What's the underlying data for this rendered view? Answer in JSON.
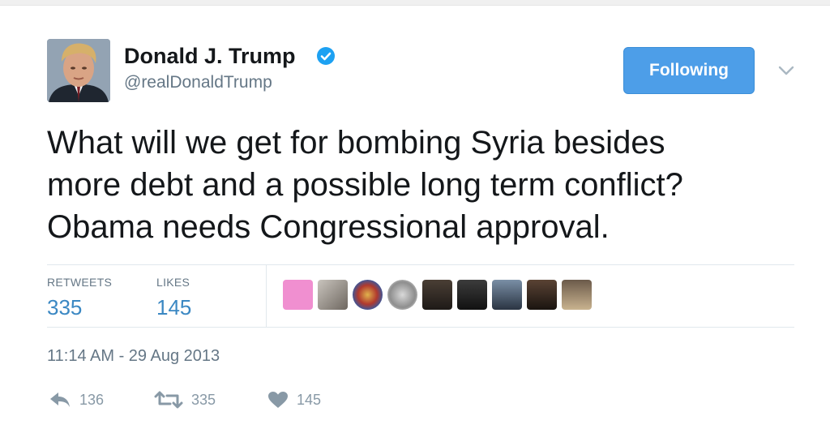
{
  "user": {
    "display_name": "Donald J. Trump",
    "handle": "@realDonaldTrump",
    "verified": true
  },
  "follow_button": {
    "label": "Following"
  },
  "tweet": {
    "lines": [
      "What will we get for bombing Syria besides",
      "more debt and a possible long term conflict?",
      "Obama needs Congressional approval."
    ]
  },
  "stats": {
    "retweets_label": "RETWEETS",
    "retweets_value": "335",
    "likes_label": "LIKES",
    "likes_value": "145"
  },
  "timestamp": "11:14 AM - 29 Aug 2013",
  "actions": {
    "reply_count": "136",
    "retweet_count": "335",
    "like_count": "145"
  },
  "colors": {
    "accent": "#4d9ee8",
    "link_blue": "#3b88c3",
    "muted": "#657786",
    "icon_gray": "#8899a6"
  }
}
